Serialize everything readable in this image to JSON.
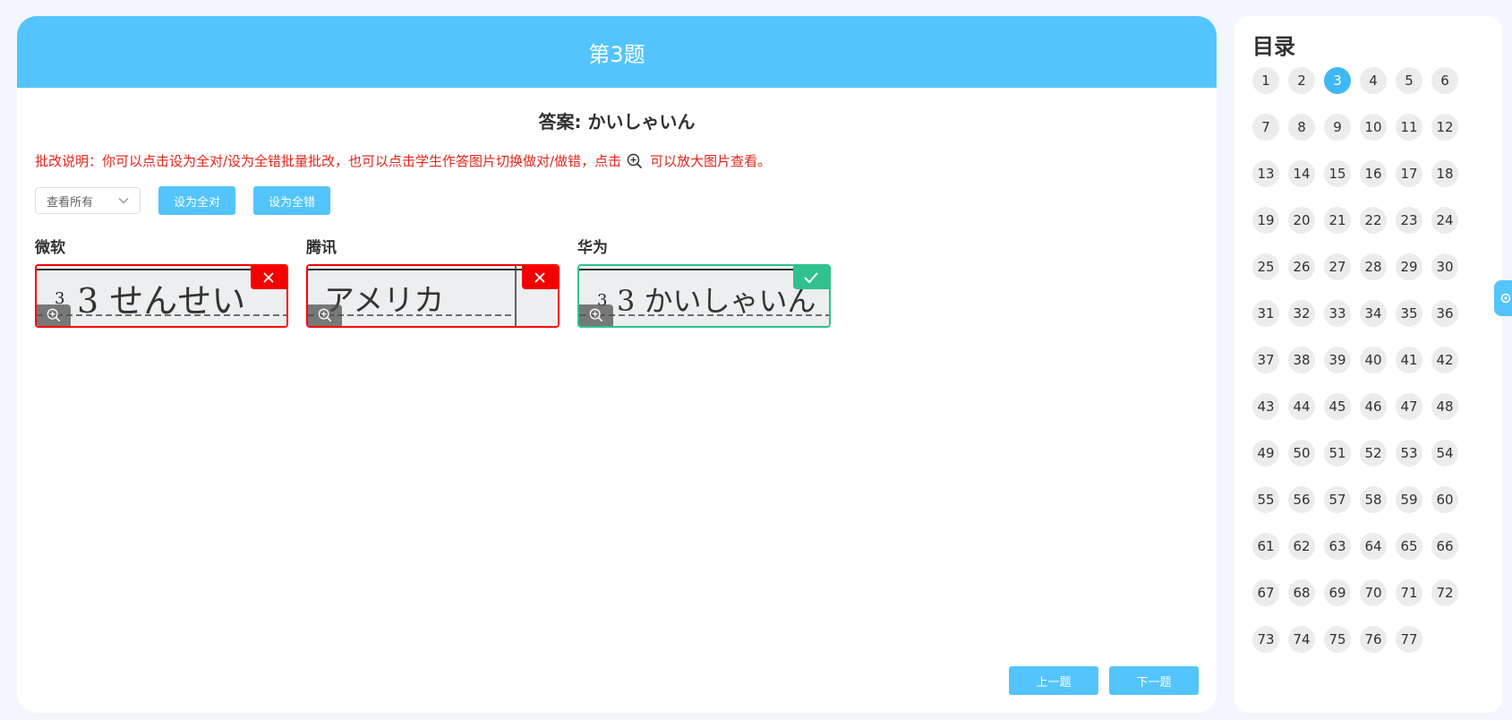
{
  "header": {
    "title": "第3题"
  },
  "answer": {
    "text": "答案: かいしゃいん"
  },
  "instructions": {
    "before": "批改说明：你可以点击设为全对/设为全错批量批改，也可以点击学生作答图片切换做对/做错，点击",
    "after": "可以放大图片查看。"
  },
  "controls": {
    "filter_value": "查看所有",
    "set_all_correct": "设为全对",
    "set_all_wrong": "设为全错"
  },
  "cards": [
    {
      "name": "微软",
      "status": "wrong",
      "handwriting": "3 せんせい"
    },
    {
      "name": "腾讯",
      "status": "wrong",
      "handwriting": "アメリカ"
    },
    {
      "name": "华为",
      "status": "correct",
      "handwriting": "3 かいしゃいん"
    }
  ],
  "nav": {
    "prev": "上一题",
    "next": "下一题"
  },
  "toc": {
    "title": "目录",
    "current": 3,
    "items": [
      "1",
      "2",
      "3",
      "4",
      "5",
      "6",
      "7",
      "8",
      "9",
      "10",
      "11",
      "12",
      "13",
      "14",
      "15",
      "16",
      "17",
      "18",
      "19",
      "20",
      "21",
      "22",
      "23",
      "24",
      "25",
      "26",
      "27",
      "28",
      "29",
      "30",
      "31",
      "32",
      "33",
      "34",
      "35",
      "36",
      "37",
      "38",
      "39",
      "40",
      "41",
      "42",
      "43",
      "44",
      "45",
      "46",
      "47",
      "48",
      "49",
      "50",
      "51",
      "52",
      "53",
      "54",
      "55",
      "56",
      "57",
      "58",
      "59",
      "60",
      "61",
      "62",
      "63",
      "64",
      "65",
      "66",
      "67",
      "68",
      "69",
      "70",
      "71",
      "72",
      "73",
      "74",
      "75",
      "76",
      "77"
    ]
  },
  "colors": {
    "accent": "#54c4fc",
    "wrong": "#f50000",
    "correct": "#2fc28f",
    "instruction": "#e4251b"
  },
  "icons": {
    "wrong_badge": "close-icon",
    "correct_badge": "check-icon",
    "zoom": "zoom-in-icon",
    "select_arrow": "chevron-down-icon",
    "side_tab": "gear-icon"
  }
}
